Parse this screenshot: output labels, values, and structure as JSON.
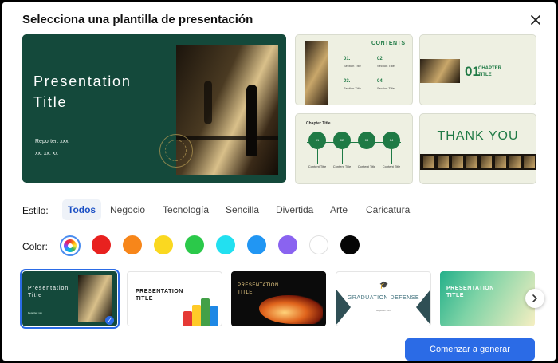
{
  "dialog": {
    "title": "Selecciona una plantilla de presentación"
  },
  "preview": {
    "title": "Presentation Title",
    "reporter": "Reporter: xxx",
    "date": "xx. xx. xx"
  },
  "thumbnails": {
    "contents": {
      "heading": "CONTENTS",
      "items": [
        {
          "num": "01.",
          "label": "Section Title"
        },
        {
          "num": "02.",
          "label": "Section Title"
        },
        {
          "num": "03.",
          "label": "Section Title"
        },
        {
          "num": "04.",
          "label": "Section Title"
        }
      ]
    },
    "chapter": {
      "num": "01",
      "title": "CHAPTER TITLE"
    },
    "timeline": {
      "heading": "Chapter Title",
      "nodes": [
        {
          "num": "01",
          "label": "Content Title"
        },
        {
          "num": "02",
          "label": "Content Title"
        },
        {
          "num": "03",
          "label": "Content Title"
        },
        {
          "num": "04",
          "label": "Content Title"
        }
      ]
    },
    "thanks": {
      "text": "THANK YOU"
    }
  },
  "style": {
    "label": "Estilo:",
    "options": [
      "Todos",
      "Negocio",
      "Tecnología",
      "Sencilla",
      "Divertida",
      "Arte",
      "Caricatura"
    ],
    "selected": "Todos"
  },
  "color": {
    "label": "Color:",
    "swatches": [
      {
        "name": "multicolor",
        "hex": ""
      },
      {
        "name": "red",
        "hex": "#e8211f"
      },
      {
        "name": "orange",
        "hex": "#f7861a"
      },
      {
        "name": "yellow",
        "hex": "#fad820"
      },
      {
        "name": "green",
        "hex": "#2bc94a"
      },
      {
        "name": "cyan",
        "hex": "#22e0f0"
      },
      {
        "name": "blue",
        "hex": "#2196f3"
      },
      {
        "name": "purple",
        "hex": "#8a63f0"
      },
      {
        "name": "white",
        "hex": "#ffffff"
      },
      {
        "name": "black",
        "hex": "#050505"
      }
    ],
    "selected": "multicolor"
  },
  "templates": [
    {
      "title": "Presentation Title",
      "reporter": "Reporter: xxx",
      "selected": true
    },
    {
      "title": "PRESENTATION TITLE"
    },
    {
      "title": "PRESENTATION TITLE"
    },
    {
      "title": "GRADUATION DEFENSE",
      "reporter": "Reporter: xxx"
    },
    {
      "title": "PRESENTATION TITLE"
    }
  ],
  "actions": {
    "generate_label": "Comenzar a generar"
  },
  "colors": {
    "accent": "#2b6be6",
    "slide_green": "#14493b"
  }
}
